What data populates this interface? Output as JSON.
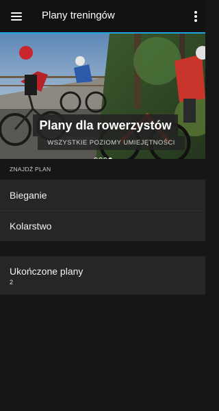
{
  "appbar": {
    "title": "Plany treningów",
    "menu_icon": "hamburger-menu-icon",
    "more_icon": "more-vert-icon"
  },
  "colors": {
    "accent": "#1fa6e0",
    "background": "#161616",
    "surface": "#262626"
  },
  "hero": {
    "title": "Plany dla rowerzystów",
    "subtitle": "WSZYSTKIE POZIOMY UMIEJĘTNOŚCI",
    "carousel": {
      "count": 4,
      "active": 4
    }
  },
  "find_plan": {
    "header": "ZNAJDŹ PLAN",
    "items": [
      {
        "label": "Bieganie"
      },
      {
        "label": "Kolarstwo"
      }
    ]
  },
  "completed": {
    "label": "Ukończone plany",
    "count": "2"
  }
}
